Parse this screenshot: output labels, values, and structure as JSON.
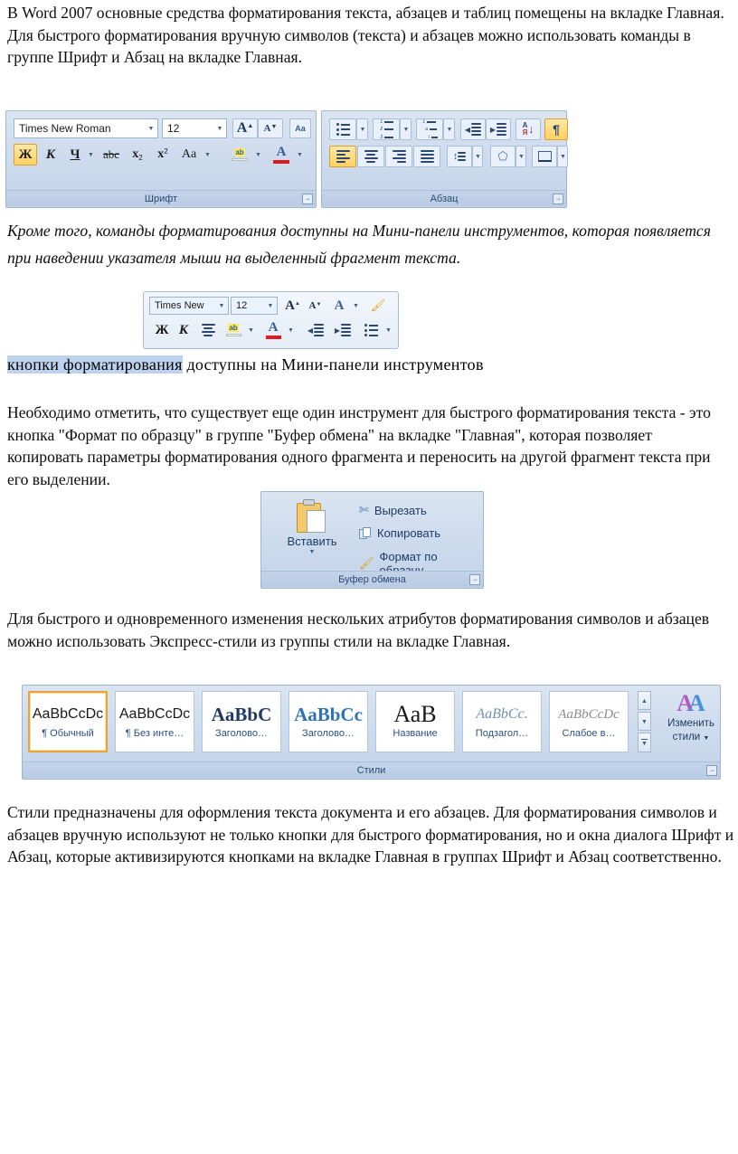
{
  "document": {
    "paragraphs": {
      "p1": "В Word 2007 основные средства форматирования текста, абзацев и таблиц помещены на вкладке Главная. Для быстрого форматирования вручную символов (текста) и абзацев можно использовать команды в группе Шрифт и Абзац на вкладке Главная.",
      "p2": "Кроме того, команды форматирования доступны на Мини-панели инструментов, которая появляется при наведении указателя мыши на выделенный фрагмент текста.",
      "p3": "Необходимо отметить, что существует еще один инструмент для быстрого форматирования текста - это кнопка \"Формат по образцу\" в группе \"Буфер обмена\" на вкладке \"Главная\", которая позволяет копировать параметры форматирования одного фрагмента и переносить на другой фрагмент текста при его выделении.",
      "p4": "Для быстрого и одновременного изменения нескольких атрибутов форматирования символов и абзацев можно использовать Экспресс-стили из группы стили на вкладке Главная.",
      "p5": "Стили предназначены для оформления текста документа и его абзацев. Для форматирования символов и абзацев вручную используют не только кнопки для быстрого форматирования, но и окна диалога Шрифт и Абзац, которые активизируются кнопками на вкладке Главная в группах Шрифт и Абзац соответственно."
    },
    "caption": {
      "highlighted": "кнопки форматирования",
      "rest": " доступны на Мини-панели инструментов"
    }
  },
  "font_group": {
    "label": "Шрифт",
    "font_name": "Times New Roman",
    "font_size": "12",
    "buttons": {
      "grow_font": "A",
      "shrink_font": "A",
      "clear_formatting": "Aa",
      "bold": "Ж",
      "italic": "К",
      "underline": "Ч",
      "strikethrough": "abc",
      "subscript": "x",
      "subscript_index": "2",
      "superscript": "x",
      "superscript_index": "2",
      "change_case": "Aa",
      "highlight": "ab",
      "font_color": "A"
    }
  },
  "paragraph_group": {
    "label": "Абзац",
    "buttons": {
      "bullets": "bullets-icon",
      "numbering": "numbering-icon",
      "multilevel_list": "multilevel-list-icon",
      "decrease_indent": "decrease-indent-icon",
      "increase_indent": "increase-indent-icon",
      "sort": "A",
      "sort_sub": "Я",
      "show_marks": "¶",
      "align_left": "align-left-icon",
      "align_center": "align-center-icon",
      "align_right": "align-right-icon",
      "justify": "justify-icon",
      "line_spacing": "line-spacing-icon",
      "shading": "shading-icon",
      "borders": "borders-icon"
    }
  },
  "mini_toolbar": {
    "font_name": "Times New",
    "font_size": "12",
    "buttons": {
      "grow_font": "A",
      "shrink_font": "A",
      "styles": "A",
      "format_painter": "format-painter-icon",
      "bold": "Ж",
      "italic": "К",
      "align_center": "align-center-icon",
      "highlight": "ab",
      "font_color": "A",
      "decrease_indent": "decrease-indent-icon",
      "increase_indent": "increase-indent-icon",
      "bullets": "bullets-icon"
    }
  },
  "clipboard_group": {
    "label": "Буфер обмена",
    "paste": "Вставить",
    "items": [
      {
        "label": "Вырезать",
        "icon": "scissors-icon"
      },
      {
        "label": "Копировать",
        "icon": "copy-icon"
      },
      {
        "label": "Формат по образцу",
        "icon": "format-painter-icon"
      }
    ]
  },
  "styles_group": {
    "label": "Стили",
    "tiles": [
      {
        "sample": "AaBbCcDc",
        "name": "¶ Обычный",
        "selected": true,
        "sample_color": "#1a1a1a",
        "sample_style": "sans",
        "sample_size": "16px"
      },
      {
        "sample": "AaBbCcDc",
        "name": "¶ Без инте…",
        "selected": false,
        "sample_color": "#1a1a1a",
        "sample_style": "sans",
        "sample_size": "16px"
      },
      {
        "sample": "AaBbC",
        "name": "Заголово…",
        "selected": false,
        "sample_color": "#1f3864",
        "sample_style": "serif-bold",
        "sample_size": "21px"
      },
      {
        "sample": "AaBbCc",
        "name": "Заголово…",
        "selected": false,
        "sample_color": "#2e74b5",
        "sample_style": "serif-bold",
        "sample_size": "21px"
      },
      {
        "sample": "АаВ",
        "name": "Название",
        "selected": false,
        "sample_color": "#1a1a1a",
        "sample_style": "serif",
        "sample_size": "26px"
      },
      {
        "sample": "AaBbCc.",
        "name": "Подзагол…",
        "selected": false,
        "sample_color": "#6f8fb0",
        "sample_style": "serif-ital",
        "sample_size": "16px"
      },
      {
        "sample": "AaBbCcDc",
        "name": "Слабое в…",
        "selected": false,
        "sample_color": "#8a8a8a",
        "sample_style": "serif-ital",
        "sample_size": "15px"
      }
    ],
    "scroll": {
      "up": "▲",
      "down": "▼",
      "more": "▼"
    },
    "change_styles": {
      "icon": "AA",
      "line1": "Изменить",
      "line2": "стили"
    }
  },
  "colors": {
    "ribbon_bg": "#cfdcee",
    "ribbon_border": "#9eb6ce",
    "label_text": "#2a4a73",
    "selection_highlight": "#bcd2ee",
    "active_button": "#ffd060",
    "style_selected_border": "#e8a33d"
  }
}
